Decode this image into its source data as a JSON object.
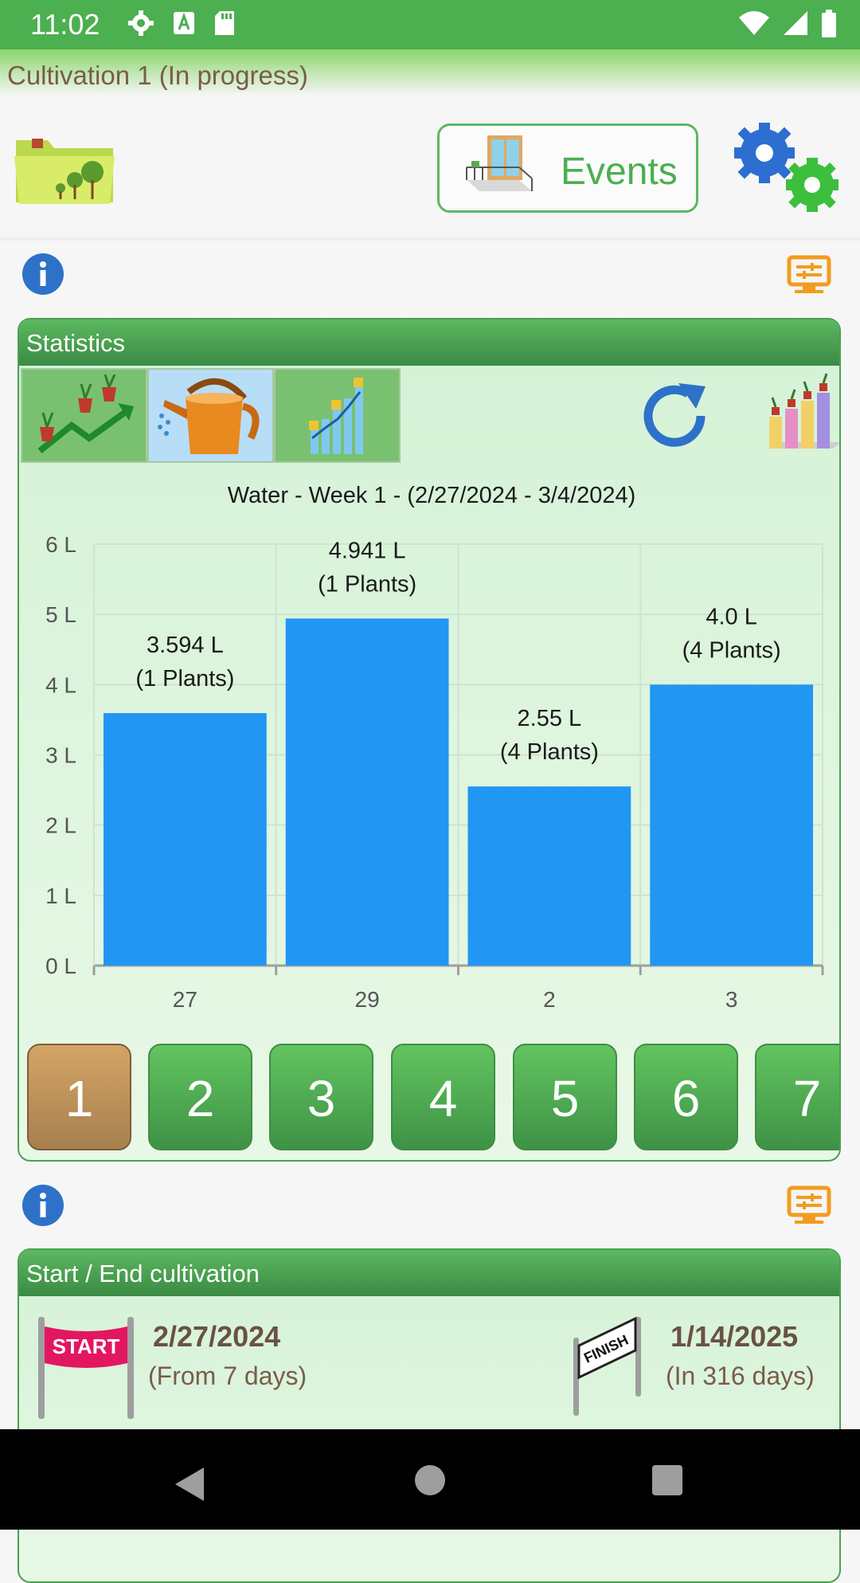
{
  "status_bar": {
    "time": "11:02"
  },
  "title": "Cultivation 1 (In progress)",
  "toolbar": {
    "events_label": "Events"
  },
  "stats_card": {
    "title": "Statistics",
    "chart_title": "Water - Week 1 - (2/27/2024 - 3/4/2024)",
    "week_buttons": [
      "1",
      "2",
      "3",
      "4",
      "5",
      "6",
      "7"
    ],
    "active_week": "1"
  },
  "chart_data": {
    "type": "bar",
    "title": "Water - Week 1 - (2/27/2024 - 3/4/2024)",
    "categories": [
      "27",
      "29",
      "2",
      "3"
    ],
    "values": [
      3.594,
      4.941,
      2.55,
      4.0
    ],
    "bar_labels": [
      [
        "3.594 L",
        "(1 Plants)"
      ],
      [
        "4.941 L",
        "(1 Plants)"
      ],
      [
        "2.55 L",
        "(4 Plants)"
      ],
      [
        "4.0 L",
        "(4 Plants)"
      ]
    ],
    "yticks": [
      "0 L",
      "1 L",
      "2 L",
      "3 L",
      "4 L",
      "5 L",
      "6 L"
    ],
    "ylim": [
      0,
      6
    ],
    "grid": true,
    "bar_color": "#2196f3"
  },
  "startend_card": {
    "title": "Start / End cultivation",
    "start_flag": "START",
    "finish_flag": "FINISH",
    "start_date": "2/27/2024",
    "start_sub": "(From 7 days)",
    "end_date": "1/14/2025",
    "end_sub": "(In 316 days)"
  },
  "colors": {
    "accent": "#4caf50",
    "bar": "#2196f3",
    "active_week": "#c0935a",
    "text_brown": "#7a5c4a"
  }
}
